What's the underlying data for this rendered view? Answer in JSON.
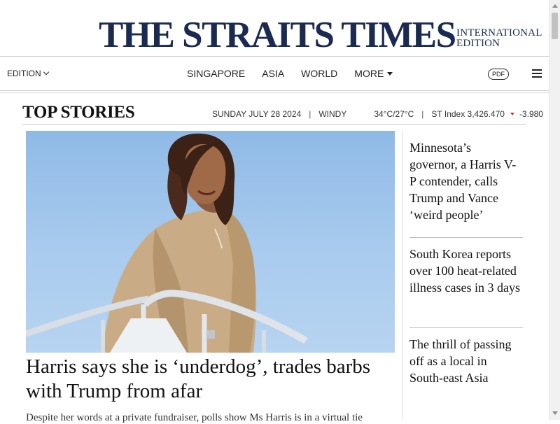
{
  "masthead": {
    "logo": "THE STRAITS TIMES",
    "edition_line1": "INTERNATIONAL",
    "edition_line2": "EDITION"
  },
  "nav": {
    "edition_label": "EDITION",
    "links": [
      "SINGAPORE",
      "ASIA",
      "WORLD",
      "MORE"
    ],
    "pdf_label": "PDF"
  },
  "section": {
    "title": "TOP STORIES",
    "date": "SUNDAY JULY 28 2024",
    "weather": "WINDY",
    "temperature": "34°C/27°C",
    "index_label": "ST Index 3,426.470",
    "index_change": "-3.980",
    "index_color": "#c0392b"
  },
  "lead": {
    "headline": "Harris says she is ‘underdog’, trades barbs with Trump from afar",
    "summary": "Despite her words at a private fundraiser, polls show Ms Harris is in a virtual tie"
  },
  "side_stories": [
    {
      "headline": "Minnesota’s governor, a Harris V-P contender, calls Trump and Vance ‘weird people’"
    },
    {
      "headline": "South Korea reports over 100 heat-related illness cases in 3 days"
    },
    {
      "headline": "The thrill of passing off as a local in South-east Asia"
    }
  ],
  "colors": {
    "brand_navy": "#1a2a50"
  }
}
